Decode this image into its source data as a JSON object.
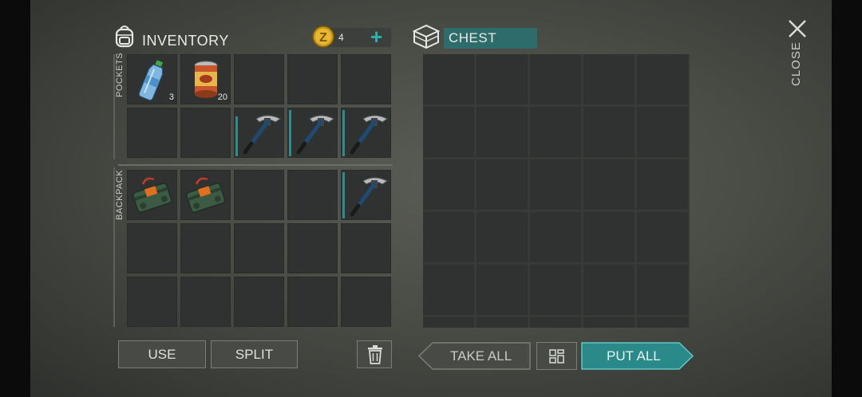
{
  "inventory": {
    "title": "INVENTORY",
    "coins": "4",
    "pockets_label": "POCKETS",
    "backpack_label": "BACKPACK",
    "pockets": [
      {
        "item": "water-bottle",
        "qty": "3"
      },
      {
        "item": "canned-food",
        "qty": "20"
      },
      {
        "item": "",
        "qty": ""
      },
      {
        "item": "",
        "qty": ""
      },
      {
        "item": "",
        "qty": ""
      },
      {
        "item": "",
        "qty": ""
      },
      {
        "item": "",
        "qty": ""
      },
      {
        "item": "pickaxe",
        "qty": ""
      },
      {
        "item": "pickaxe",
        "qty": ""
      },
      {
        "item": "pickaxe",
        "qty": ""
      }
    ],
    "backpack": [
      {
        "item": "dynamite-pack",
        "qty": ""
      },
      {
        "item": "dynamite-pack",
        "qty": ""
      },
      {
        "item": "",
        "qty": ""
      },
      {
        "item": "",
        "qty": ""
      },
      {
        "item": "pickaxe",
        "qty": ""
      },
      {
        "item": "",
        "qty": ""
      },
      {
        "item": "",
        "qty": ""
      },
      {
        "item": "",
        "qty": ""
      },
      {
        "item": "",
        "qty": ""
      },
      {
        "item": "",
        "qty": ""
      },
      {
        "item": "",
        "qty": ""
      },
      {
        "item": "",
        "qty": ""
      },
      {
        "item": "",
        "qty": ""
      },
      {
        "item": "",
        "qty": ""
      },
      {
        "item": "",
        "qty": ""
      }
    ]
  },
  "chest": {
    "title": "CHEST"
  },
  "buttons": {
    "use": "USE",
    "split": "SPLIT",
    "take_all": "TAKE ALL",
    "put_all": "PUT ALL",
    "close": "CLOSE"
  },
  "colors": {
    "accent": "#2a8a8a",
    "cell": "#2f3230",
    "durability": "#2d8c8c"
  },
  "icons": [
    "backpack-icon",
    "coin-icon",
    "plus-icon",
    "chest-icon",
    "close-icon",
    "trash-icon",
    "sort-grid-icon"
  ]
}
